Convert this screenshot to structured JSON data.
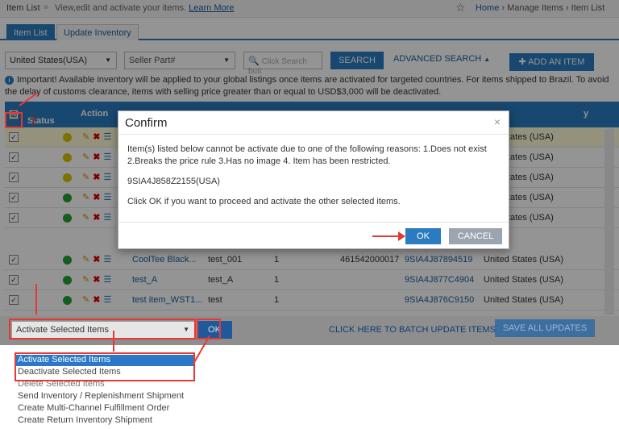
{
  "header": {
    "title": "Item List",
    "separator": "»",
    "subtitle": "View,edit and activate your items.",
    "learn_more": "Learn More",
    "breadcrumb_home": "Home",
    "breadcrumb_mid": "Manage Items",
    "breadcrumb_current": "Item List"
  },
  "tabs": [
    {
      "label": "Item List",
      "active": true
    },
    {
      "label": "Update Inventory",
      "active": false
    }
  ],
  "filters": {
    "country": "United States(USA)",
    "field": "Seller Part#",
    "search_placeholder": "Click Search butt",
    "search_button": "SEARCH",
    "advanced_search": "ADVANCED SEARCH",
    "add_item": "ADD AN ITEM"
  },
  "notice": {
    "text": "Important! Available inventory will be applied to your global listings once items are activated for targeted countries. For items shipped to Brazil. To avoid the delay of customs clearance, items with selling price greater than or equal to USD$3,000 will be deactivated."
  },
  "table": {
    "headers": {
      "status": "Status",
      "action": "Action",
      "country_partial": "y"
    },
    "rows": [
      {
        "status_color": "#d4c600",
        "name": "",
        "part": "",
        "qty": "",
        "upc": "",
        "item_no": "",
        "country": "tates (USA)"
      },
      {
        "status_color": "#d4c600",
        "name": "",
        "part": "",
        "qty": "",
        "upc": "",
        "item_no": "",
        "country": "tates (USA)"
      },
      {
        "status_color": "#d4c600",
        "name": "",
        "part": "",
        "qty": "",
        "upc": "",
        "item_no": "",
        "country": "tates (USA)"
      },
      {
        "status_color": "#22a136",
        "name": "",
        "part": "",
        "qty": "",
        "upc": "",
        "item_no": "",
        "country": "tates (USA)"
      },
      {
        "status_color": "#22a136",
        "name": "",
        "part": "",
        "qty": "",
        "upc": "",
        "item_no": "",
        "country": "tates (USA)"
      },
      {
        "status_color": "#22a136",
        "name": "CoolTee Black...",
        "part": "test_001",
        "qty": "1",
        "upc": "461542000017",
        "item_no": "9SIA4J87894519",
        "country": "United States (USA)"
      },
      {
        "status_color": "#22a136",
        "name": "test_A",
        "part": "test_A",
        "qty": "1",
        "upc": "",
        "item_no": "9SIA4J877C4904",
        "country": "United States (USA)"
      },
      {
        "status_color": "#22a136",
        "name": "test item_WST1...",
        "part": "test",
        "qty": "1",
        "upc": "",
        "item_no": "9SIA4J876C9150",
        "country": "United States (USA)"
      }
    ]
  },
  "modal": {
    "title": "Confirm",
    "close": "×",
    "line1": "Item(s) listed below cannot be activate due to one of the following reasons: 1.Does not exist 2.Breaks the price rule 3.Has no image 4. Item has been restricted.",
    "item": "9SIA4J858Z2155(USA)",
    "line3": "Click OK if you want to proceed and activate the other selected items.",
    "ok": "OK",
    "cancel": "CANCEL"
  },
  "bottom": {
    "action_select": "Activate Selected Items",
    "ok": "OK",
    "batch_link": "CLICK HERE TO BATCH UPDATE ITEMS",
    "save_all": "SAVE ALL UPDATES"
  },
  "dropdown": {
    "items": [
      "Activate Selected Items",
      "Deactivate Selected Items",
      "Delete Selected Items",
      "Send Inventory / Replenishment Shipment",
      "Create Multi-Channel Fulfillment Order",
      "Create Return Inventory Shipment"
    ]
  },
  "colors": {
    "primary": "#2a7bbf",
    "annotation": "#e53935",
    "highlight_row": "#fffbd6"
  }
}
